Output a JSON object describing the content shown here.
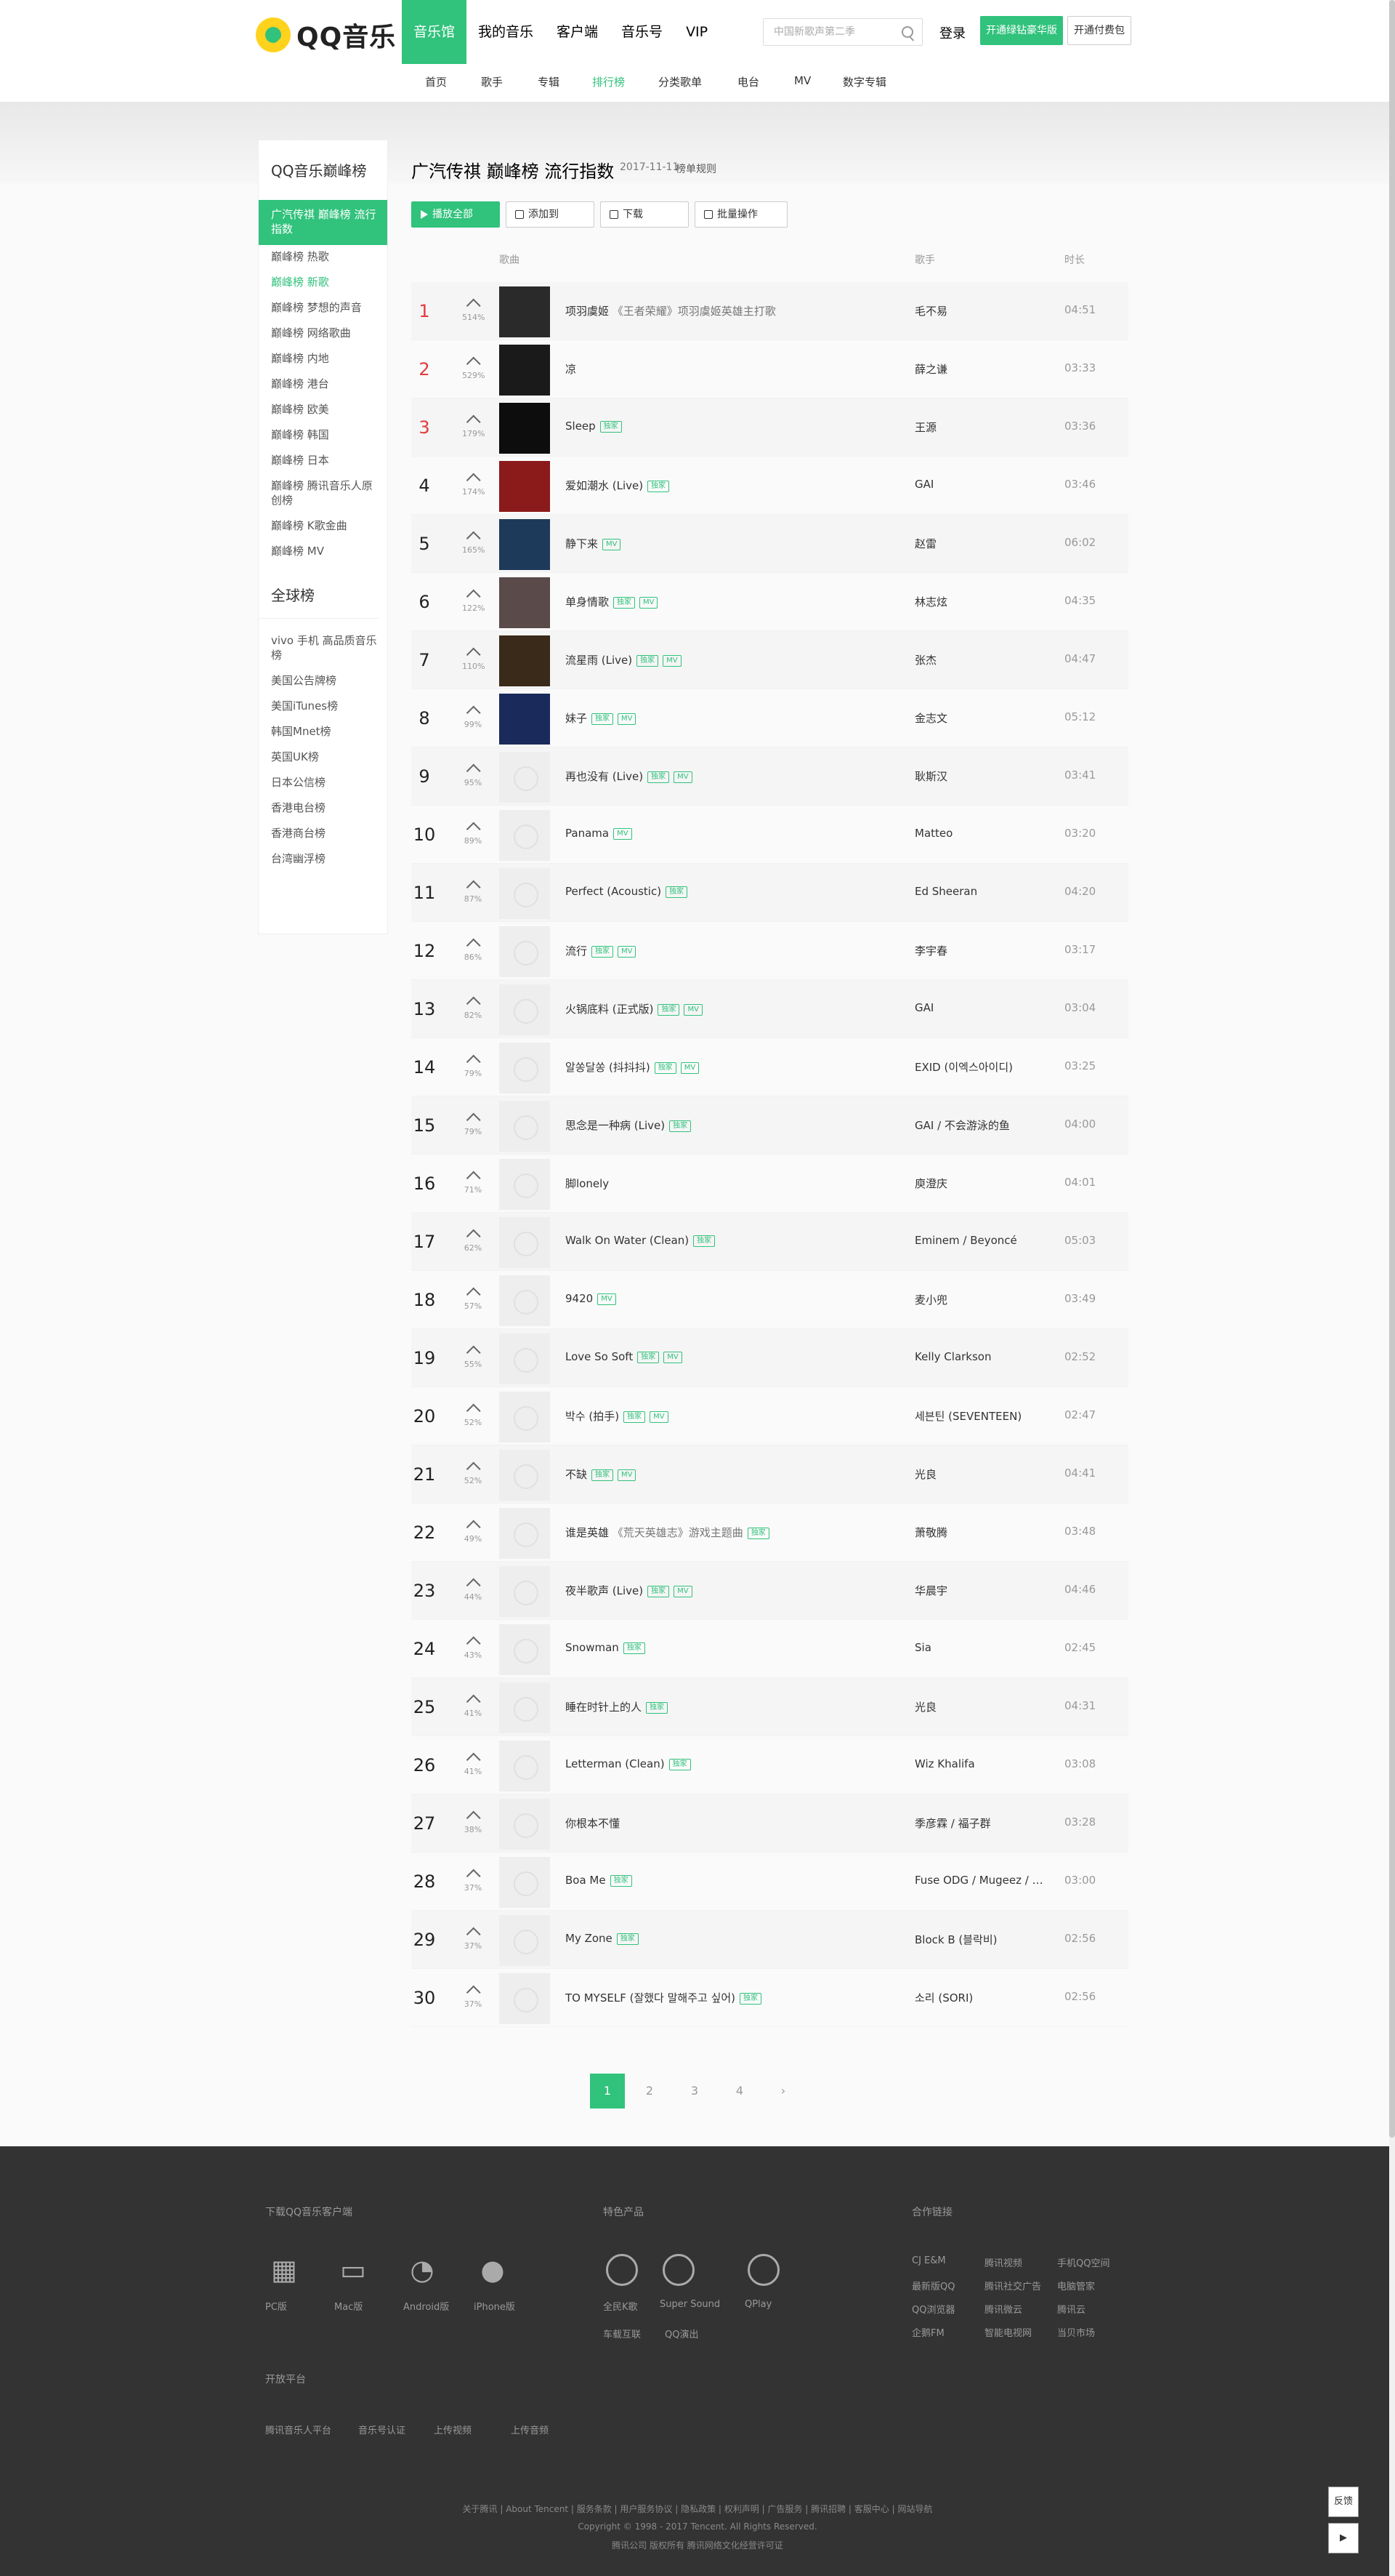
{
  "header": {
    "logo_text": "QQ音乐",
    "nav": [
      "音乐馆",
      "我的音乐",
      "客户端",
      "音乐号",
      "VIP"
    ],
    "search_placeholder": "中国新歌声第二季",
    "login": "登录",
    "green_btn": "开通绿钻豪华版",
    "white_btn": "开通付费包"
  },
  "subnav": [
    "首页",
    "歌手",
    "专辑",
    "排行榜",
    "分类歌单",
    "电台",
    "MV",
    "数字专辑"
  ],
  "sidebar": {
    "title": "QQ音乐巅峰榜",
    "items": [
      "广汽传祺 巅峰榜 流行指数",
      "巅峰榜 热歌",
      "巅峰榜 新歌",
      "巅峰榜 梦想的声音",
      "巅峰榜 网络歌曲",
      "巅峰榜 内地",
      "巅峰榜 港台",
      "巅峰榜 欧美",
      "巅峰榜 韩国",
      "巅峰榜 日本",
      "巅峰榜 腾讯音乐人原创榜",
      "巅峰榜 K歌金曲",
      "巅峰榜 MV"
    ],
    "global_title": "全球榜",
    "global_items": [
      "vivo 手机 高品质音乐榜",
      "美国公告牌榜",
      "美国iTunes榜",
      "韩国Mnet榜",
      "英国UK榜",
      "日本公信榜",
      "香港电台榜",
      "香港商台榜",
      "台湾幽浮榜"
    ]
  },
  "main": {
    "title": "广汽传祺 巅峰榜 流行指数",
    "date": "2017-11-11",
    "rule": "榜单规则",
    "actions": [
      "播放全部",
      "添加到",
      "下载",
      "批量操作"
    ],
    "col_song": "歌曲",
    "col_singer": "歌手",
    "col_duration": "时长"
  },
  "songs": [
    {
      "rank": "1",
      "trend": "514%",
      "name": "项羽虞姬",
      "sub": "《王者荣耀》项羽虞姬英雄主打歌",
      "tags": [],
      "singer": "毛不易",
      "duration": "04:51",
      "img": "#2a2a2a"
    },
    {
      "rank": "2",
      "trend": "529%",
      "name": "凉",
      "sub": "",
      "tags": [],
      "singer": "薛之谦",
      "duration": "03:33",
      "img": "#1a1a1a"
    },
    {
      "rank": "3",
      "trend": "179%",
      "name": "Sleep",
      "sub": "",
      "tags": [
        "独家"
      ],
      "singer": "王源",
      "duration": "03:36",
      "img": "#0d0d0d"
    },
    {
      "rank": "4",
      "trend": "174%",
      "name": "爱如潮水 (Live)",
      "sub": "",
      "tags": [
        "独家"
      ],
      "singer": "GAI",
      "duration": "03:46",
      "img": "#8b1a1a"
    },
    {
      "rank": "5",
      "trend": "165%",
      "name": "静下来",
      "sub": "",
      "tags": [
        "MV"
      ],
      "singer": "赵雷",
      "duration": "06:02",
      "img": "#1e3a5a"
    },
    {
      "rank": "6",
      "trend": "122%",
      "name": "单身情歌",
      "sub": "",
      "tags": [
        "独家",
        "MV"
      ],
      "singer": "林志炫",
      "duration": "04:35",
      "img": "#5a4a4a"
    },
    {
      "rank": "7",
      "trend": "110%",
      "name": "流星雨 (Live)",
      "sub": "",
      "tags": [
        "独家",
        "MV"
      ],
      "singer": "张杰",
      "duration": "04:47",
      "img": "#3a2a1a"
    },
    {
      "rank": "8",
      "trend": "99%",
      "name": "妹子",
      "sub": "",
      "tags": [
        "独家",
        "MV"
      ],
      "singer": "金志文",
      "duration": "05:12",
      "img": "#1a2a5a"
    },
    {
      "rank": "9",
      "trend": "95%",
      "name": "再也没有 (Live)",
      "sub": "",
      "tags": [
        "独家",
        "MV"
      ],
      "singer": "耿斯汉",
      "duration": "03:41",
      "img": ""
    },
    {
      "rank": "10",
      "trend": "89%",
      "name": "Panama",
      "sub": "",
      "tags": [
        "MV"
      ],
      "singer": "Matteo",
      "duration": "03:20",
      "img": ""
    },
    {
      "rank": "11",
      "trend": "87%",
      "name": "Perfect (Acoustic)",
      "sub": "",
      "tags": [
        "独家"
      ],
      "singer": "Ed Sheeran",
      "duration": "04:20",
      "img": ""
    },
    {
      "rank": "12",
      "trend": "86%",
      "name": "流行",
      "sub": "",
      "tags": [
        "独家",
        "MV"
      ],
      "singer": "李宇春",
      "duration": "03:17",
      "img": ""
    },
    {
      "rank": "13",
      "trend": "82%",
      "name": "火锅底料 (正式版)",
      "sub": "",
      "tags": [
        "独家",
        "MV"
      ],
      "singer": "GAI",
      "duration": "03:04",
      "img": ""
    },
    {
      "rank": "14",
      "trend": "79%",
      "name": "알쏭달쏭 (抖抖抖)",
      "sub": "",
      "tags": [
        "独家",
        "MV"
      ],
      "singer": "EXID (이엑스아이디)",
      "duration": "03:25",
      "img": ""
    },
    {
      "rank": "15",
      "trend": "79%",
      "name": "思念是一种病 (Live)",
      "sub": "",
      "tags": [
        "独家"
      ],
      "singer": "GAI / 不会游泳的鱼",
      "duration": "04:00",
      "img": ""
    },
    {
      "rank": "16",
      "trend": "71%",
      "name": "脚lonely",
      "sub": "",
      "tags": [],
      "singer": "庾澄庆",
      "duration": "04:01",
      "img": ""
    },
    {
      "rank": "17",
      "trend": "62%",
      "name": "Walk On Water (Clean)",
      "sub": "",
      "tags": [
        "独家"
      ],
      "singer": "Eminem / Beyoncé",
      "duration": "05:03",
      "img": ""
    },
    {
      "rank": "18",
      "trend": "57%",
      "name": "9420",
      "sub": "",
      "tags": [
        "MV"
      ],
      "singer": "麦小兜",
      "duration": "03:49",
      "img": ""
    },
    {
      "rank": "19",
      "trend": "55%",
      "name": "Love So Soft",
      "sub": "",
      "tags": [
        "独家",
        "MV"
      ],
      "singer": "Kelly Clarkson",
      "duration": "02:52",
      "img": ""
    },
    {
      "rank": "20",
      "trend": "52%",
      "name": "박수 (拍手)",
      "sub": "",
      "tags": [
        "独家",
        "MV"
      ],
      "singer": "세븐틴 (SEVENTEEN)",
      "duration": "02:47",
      "img": ""
    },
    {
      "rank": "21",
      "trend": "52%",
      "name": "不缺",
      "sub": "",
      "tags": [
        "独家",
        "MV"
      ],
      "singer": "光良",
      "duration": "04:41",
      "img": ""
    },
    {
      "rank": "22",
      "trend": "49%",
      "name": "谁是英雄",
      "sub": "《荒天英雄志》游戏主题曲",
      "tags": [
        "独家"
      ],
      "singer": "萧敬腾",
      "duration": "03:48",
      "img": ""
    },
    {
      "rank": "23",
      "trend": "44%",
      "name": "夜半歌声 (Live)",
      "sub": "",
      "tags": [
        "独家",
        "MV"
      ],
      "singer": "华晨宇",
      "duration": "04:46",
      "img": ""
    },
    {
      "rank": "24",
      "trend": "43%",
      "name": "Snowman",
      "sub": "",
      "tags": [
        "独家"
      ],
      "singer": "Sia",
      "duration": "02:45",
      "img": ""
    },
    {
      "rank": "25",
      "trend": "41%",
      "name": "睡在时针上的人",
      "sub": "",
      "tags": [
        "独家"
      ],
      "singer": "光良",
      "duration": "04:31",
      "img": ""
    },
    {
      "rank": "26",
      "trend": "41%",
      "name": "Letterman (Clean)",
      "sub": "",
      "tags": [
        "独家"
      ],
      "singer": "Wiz Khalifa",
      "duration": "03:08",
      "img": ""
    },
    {
      "rank": "27",
      "trend": "38%",
      "name": "你根本不懂",
      "sub": "",
      "tags": [],
      "singer": "季彦霖 / 福子群",
      "duration": "03:28",
      "img": ""
    },
    {
      "rank": "28",
      "trend": "37%",
      "name": "Boa Me",
      "sub": "",
      "tags": [
        "独家"
      ],
      "singer": "Fuse ODG / Mugeez / E...",
      "duration": "03:00",
      "img": ""
    },
    {
      "rank": "29",
      "trend": "37%",
      "name": "My Zone",
      "sub": "",
      "tags": [
        "独家"
      ],
      "singer": "Block B (블락비)",
      "duration": "02:56",
      "img": ""
    },
    {
      "rank": "30",
      "trend": "37%",
      "name": "TO MYSELF (잘했다 말해주고 싶어)",
      "sub": "",
      "tags": [
        "独家"
      ],
      "singer": "소리 (SORI)",
      "duration": "02:56",
      "img": ""
    }
  ],
  "pager": [
    "1",
    "2",
    "3",
    "4",
    "›"
  ],
  "footer": {
    "download_title": "下载QQ音乐客户端",
    "platforms": [
      "PC版",
      "Mac版",
      "Android版",
      "iPhone版"
    ],
    "products_title": "特色产品",
    "products": [
      "全民K歌",
      "Super Sound",
      "QPlay"
    ],
    "products2": [
      "车载互联",
      "QQ演出"
    ],
    "partners_title": "合作链接",
    "partners": [
      "CJ E&M",
      "腾讯视频",
      "手机QQ空间",
      "最新版QQ",
      "腾讯社交广告",
      "电脑管家",
      "QQ浏览器",
      "腾讯微云",
      "腾讯云",
      "企鹅FM",
      "智能电视网",
      "当贝市场"
    ],
    "open_title": "开放平台",
    "open": [
      "腾讯音乐人平台",
      "音乐号认证",
      "上传视频",
      "上传音频"
    ],
    "links": "关于腾讯 | About Tencent | 服务条款 | 用户服务协议 | 隐私政策 | 权利声明 | 广告服务 | 腾讯招聘 | 客服中心 | 网站导航",
    "copyright": "Copyright © 1998 - 2017 Tencent. All Rights Reserved.",
    "license": "腾讯公司 版权所有 腾讯网络文化经营许可证",
    "feedback": "反馈"
  },
  "colors": {
    "accent": "#31c27c",
    "rank_top": "#e4393c",
    "footer_bg": "#333333"
  }
}
